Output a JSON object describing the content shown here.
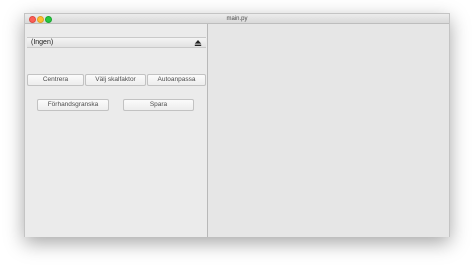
{
  "window": {
    "title": "main.py"
  },
  "left_panel": {
    "combo": {
      "selected": "(Ingen)",
      "icon": "eject-icon"
    },
    "buttons_row1": {
      "centrera": "Centrera",
      "valj_skalfaktor": "Välj skalfaktor",
      "autoanpassa": "Autoanpassa"
    },
    "buttons_row2": {
      "forhandsgranska": "Förhandsgranska",
      "spara": "Spara"
    }
  },
  "colors": {
    "close": "#fc5f57",
    "minimize": "#fdbd2e",
    "maximize": "#28c840"
  }
}
